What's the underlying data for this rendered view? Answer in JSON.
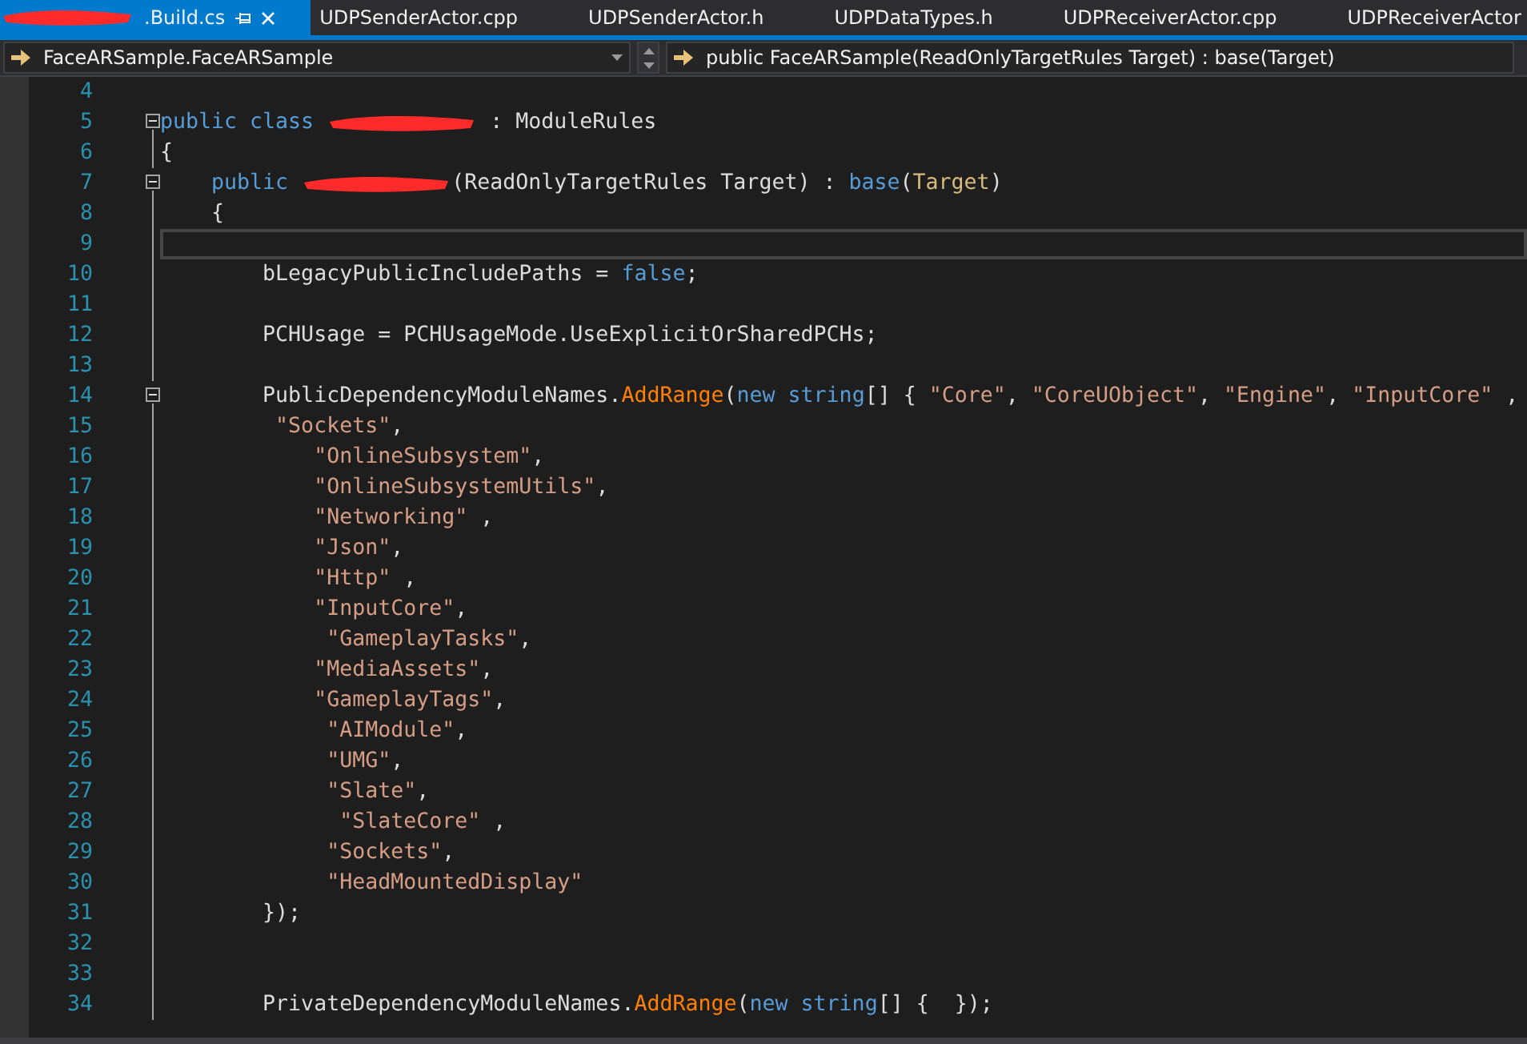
{
  "tabs": [
    {
      "title": ".Build.cs",
      "redacted": true,
      "selected": true,
      "pinned": true
    },
    {
      "title": "UDPSenderActor.cpp",
      "redacted": false,
      "selected": false,
      "pinned": false
    },
    {
      "title": "UDPSenderActor.h",
      "redacted": false,
      "selected": false,
      "pinned": false
    },
    {
      "title": "UDPDataTypes.h",
      "redacted": false,
      "selected": false,
      "pinned": false
    },
    {
      "title": "UDPReceiverActor.cpp",
      "redacted": false,
      "selected": false,
      "pinned": false
    },
    {
      "title": "UDPReceiverActor",
      "redacted": false,
      "selected": false,
      "pinned": false
    }
  ],
  "navigation": {
    "type_selector": "FaceARSample.FaceARSample",
    "member_selector": "public FaceARSample(ReadOnlyTargetRules Target) : base(Target)"
  },
  "lines": [
    {
      "number": "4",
      "collapsible": false,
      "current": false
    },
    {
      "number": "5",
      "collapsible": true,
      "current": false,
      "tokens": [
        {
          "kind": "keyword",
          "text": "public class "
        },
        {
          "kind": "redaction"
        },
        {
          "kind": "plain",
          "text": " : ModuleRules"
        }
      ]
    },
    {
      "number": "6",
      "collapsible": false,
      "current": false,
      "tokens": [
        {
          "kind": "plain",
          "text": "{"
        }
      ]
    },
    {
      "number": "7",
      "collapsible": true,
      "current": false,
      "tokens": [
        {
          "kind": "keyword",
          "text": "    public "
        },
        {
          "kind": "redaction"
        },
        {
          "kind": "plain",
          "text": "(ReadOnlyTargetRules Target) : "
        },
        {
          "kind": "keyword",
          "text": "base"
        },
        {
          "kind": "plain",
          "text": "("
        },
        {
          "kind": "param",
          "text": "Target"
        },
        {
          "kind": "plain",
          "text": ")"
        }
      ]
    },
    {
      "number": "8",
      "collapsible": false,
      "current": false,
      "tokens": [
        {
          "kind": "plain",
          "text": "    {"
        }
      ]
    },
    {
      "number": "9",
      "collapsible": false,
      "current": true
    },
    {
      "number": "10",
      "collapsible": false,
      "current": false,
      "tokens": [
        {
          "kind": "plain",
          "text": "        bLegacyPublicIncludePaths = "
        },
        {
          "kind": "keyword",
          "text": "false"
        },
        {
          "kind": "plain",
          "text": ";"
        }
      ]
    },
    {
      "number": "11",
      "collapsible": false,
      "current": false
    },
    {
      "number": "12",
      "collapsible": false,
      "current": false,
      "tokens": [
        {
          "kind": "plain",
          "text": "        PCHUsage = PCHUsageMode.UseExplicitOrSharedPCHs;"
        }
      ]
    },
    {
      "number": "13",
      "collapsible": false,
      "current": false
    },
    {
      "number": "14",
      "collapsible": true,
      "current": false,
      "tokens": [
        {
          "kind": "plain",
          "text": "        PublicDependencyModuleNames."
        },
        {
          "kind": "method",
          "text": "AddRange"
        },
        {
          "kind": "plain",
          "text": "("
        },
        {
          "kind": "keyword",
          "text": "new string"
        },
        {
          "kind": "plain",
          "text": "[] { "
        },
        {
          "kind": "string",
          "text": "\"Core\""
        },
        {
          "kind": "plain",
          "text": ", "
        },
        {
          "kind": "string",
          "text": "\"CoreUObject\""
        },
        {
          "kind": "plain",
          "text": ", "
        },
        {
          "kind": "string",
          "text": "\"Engine\""
        },
        {
          "kind": "plain",
          "text": ", "
        },
        {
          "kind": "string",
          "text": "\"InputCore\""
        },
        {
          "kind": "plain",
          "text": " ,"
        }
      ]
    },
    {
      "number": "15",
      "collapsible": false,
      "current": false,
      "tokens": [
        {
          "kind": "string",
          "text": "         \"Sockets\""
        },
        {
          "kind": "plain",
          "text": ","
        }
      ]
    },
    {
      "number": "16",
      "collapsible": false,
      "current": false,
      "tokens": [
        {
          "kind": "string",
          "text": "            \"OnlineSubsystem\""
        },
        {
          "kind": "plain",
          "text": ","
        }
      ]
    },
    {
      "number": "17",
      "collapsible": false,
      "current": false,
      "tokens": [
        {
          "kind": "string",
          "text": "            \"OnlineSubsystemUtils\""
        },
        {
          "kind": "plain",
          "text": ","
        }
      ]
    },
    {
      "number": "18",
      "collapsible": false,
      "current": false,
      "tokens": [
        {
          "kind": "string",
          "text": "            \"Networking\""
        },
        {
          "kind": "plain",
          "text": " ,"
        }
      ]
    },
    {
      "number": "19",
      "collapsible": false,
      "current": false,
      "tokens": [
        {
          "kind": "string",
          "text": "            \"Json\""
        },
        {
          "kind": "plain",
          "text": ","
        }
      ]
    },
    {
      "number": "20",
      "collapsible": false,
      "current": false,
      "tokens": [
        {
          "kind": "string",
          "text": "            \"Http\""
        },
        {
          "kind": "plain",
          "text": " ,"
        }
      ]
    },
    {
      "number": "21",
      "collapsible": false,
      "current": false,
      "tokens": [
        {
          "kind": "string",
          "text": "            \"InputCore\""
        },
        {
          "kind": "plain",
          "text": ","
        }
      ]
    },
    {
      "number": "22",
      "collapsible": false,
      "current": false,
      "tokens": [
        {
          "kind": "string",
          "text": "             \"GameplayTasks\""
        },
        {
          "kind": "plain",
          "text": ","
        }
      ]
    },
    {
      "number": "23",
      "collapsible": false,
      "current": false,
      "tokens": [
        {
          "kind": "string",
          "text": "            \"MediaAssets\""
        },
        {
          "kind": "plain",
          "text": ","
        }
      ]
    },
    {
      "number": "24",
      "collapsible": false,
      "current": false,
      "tokens": [
        {
          "kind": "string",
          "text": "            \"GameplayTags\""
        },
        {
          "kind": "plain",
          "text": ","
        }
      ]
    },
    {
      "number": "25",
      "collapsible": false,
      "current": false,
      "tokens": [
        {
          "kind": "string",
          "text": "             \"AIModule\""
        },
        {
          "kind": "plain",
          "text": ","
        }
      ]
    },
    {
      "number": "26",
      "collapsible": false,
      "current": false,
      "tokens": [
        {
          "kind": "string",
          "text": "             \"UMG\""
        },
        {
          "kind": "plain",
          "text": ","
        }
      ]
    },
    {
      "number": "27",
      "collapsible": false,
      "current": false,
      "tokens": [
        {
          "kind": "string",
          "text": "             \"Slate\""
        },
        {
          "kind": "plain",
          "text": ","
        }
      ]
    },
    {
      "number": "28",
      "collapsible": false,
      "current": false,
      "tokens": [
        {
          "kind": "string",
          "text": "              \"SlateCore\""
        },
        {
          "kind": "plain",
          "text": " ,"
        }
      ]
    },
    {
      "number": "29",
      "collapsible": false,
      "current": false,
      "tokens": [
        {
          "kind": "string",
          "text": "             \"Sockets\""
        },
        {
          "kind": "plain",
          "text": ","
        }
      ]
    },
    {
      "number": "30",
      "collapsible": false,
      "current": false,
      "tokens": [
        {
          "kind": "string",
          "text": "             \"HeadMountedDisplay\""
        }
      ]
    },
    {
      "number": "31",
      "collapsible": false,
      "current": false,
      "tokens": [
        {
          "kind": "plain",
          "text": "        });"
        }
      ]
    },
    {
      "number": "32",
      "collapsible": false,
      "current": false
    },
    {
      "number": "33",
      "collapsible": false,
      "current": false
    },
    {
      "number": "34",
      "collapsible": false,
      "current": false,
      "tokens": [
        {
          "kind": "plain",
          "text": "        PrivateDependencyModuleNames."
        },
        {
          "kind": "method",
          "text": "AddRange"
        },
        {
          "kind": "plain",
          "text": "("
        },
        {
          "kind": "keyword",
          "text": "new string"
        },
        {
          "kind": "plain",
          "text": "[] {  });"
        }
      ]
    }
  ]
}
